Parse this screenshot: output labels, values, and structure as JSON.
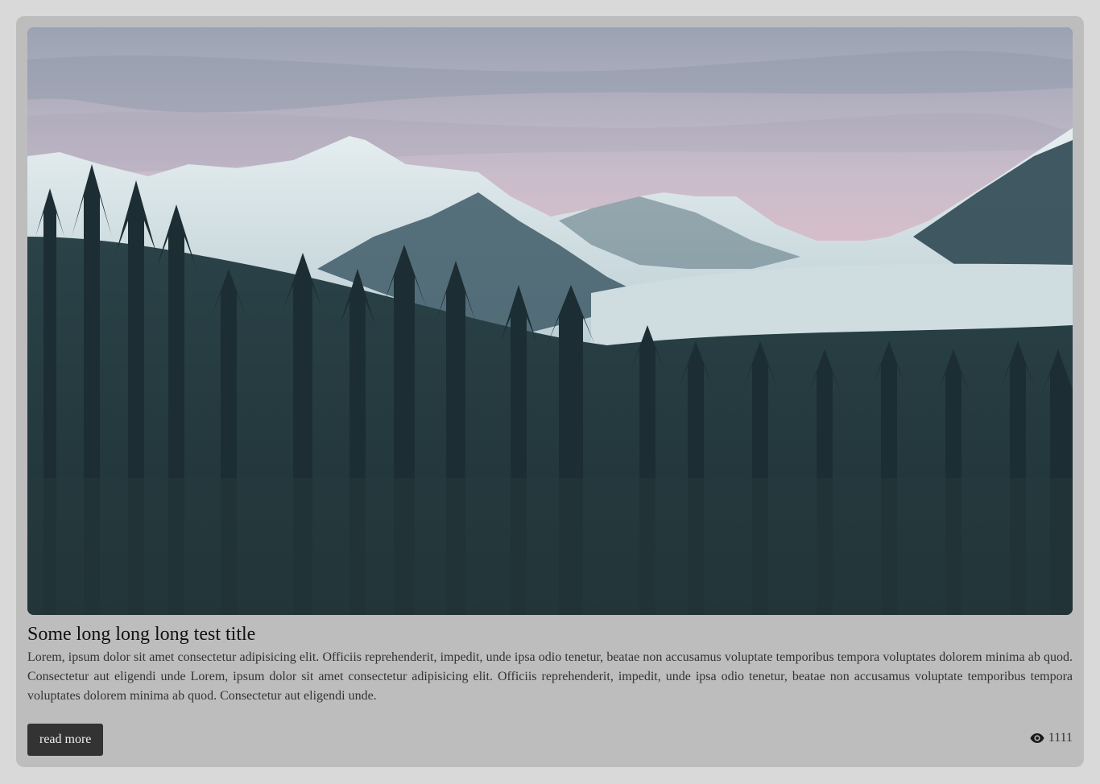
{
  "card": {
    "image_alt": "Snowy mountains above a dark pine forest at dusk",
    "title": "Some long long long test title",
    "description": "Lorem, ipsum dolor sit amet consectetur adipisicing elit. Officiis reprehenderit, impedit, unde ipsa odio tenetur, beatae non accusamus voluptate temporibus tempora voluptates dolorem minima ab quod. Consectetur aut eligendi unde Lorem, ipsum dolor sit amet consectetur adipisicing elit. Officiis reprehenderit, impedit, unde ipsa odio tenetur, beatae non accusamus voluptate temporibus tempora voluptates dolorem minima ab quod. Consectetur aut eligendi unde.",
    "read_more_label": "read more",
    "views_icon": "eye-icon",
    "views_count": "1111"
  },
  "colors": {
    "page_background": "#d9d9d9",
    "card_background": "#bdbdbd",
    "button_background": "#333333",
    "button_text": "#eeeeee"
  }
}
